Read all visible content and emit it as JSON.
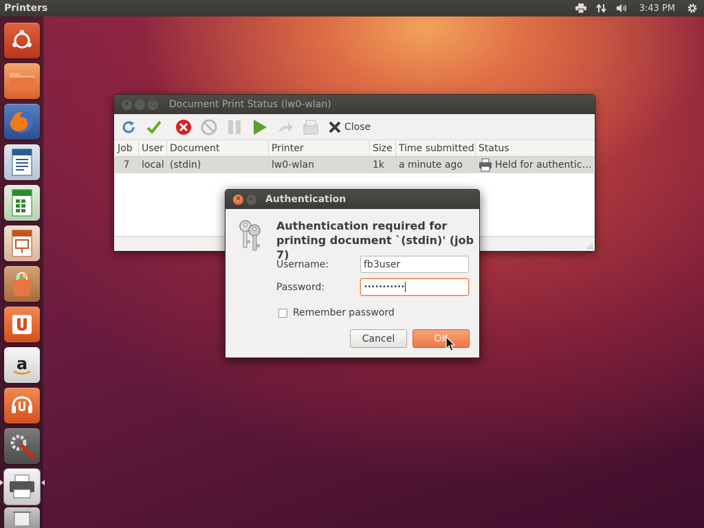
{
  "topbar": {
    "app_title": "Printers",
    "time": "3:43 PM",
    "tray_icons": [
      "printer-icon",
      "network-icon",
      "volume-icon",
      "gear-icon"
    ]
  },
  "launcher": {
    "items": [
      "dash-home-icon",
      "files-icon",
      "firefox-icon",
      "writer-icon",
      "calc-icon",
      "impress-icon",
      "software-center-icon",
      "ubuntu-one-icon",
      "amazon-icon",
      "ubuntu-one-music-icon",
      "system-settings-icon",
      "printer-app-icon",
      "trash-icon"
    ]
  },
  "print_status_window": {
    "title": "Document Print Status (lw0-wlan)",
    "toolbar": {
      "icons": [
        "refresh-icon",
        "release-icon",
        "cancel-job-icon",
        "delete-job-icon",
        "hold-icon",
        "start-icon",
        "reprint-icon",
        "retrieve-icon"
      ],
      "close_label": "Close"
    },
    "columns": [
      "Job",
      "User",
      "Document",
      "Printer",
      "Size",
      "Time submitted",
      "Status"
    ],
    "rows": [
      {
        "job": "7",
        "user": "local",
        "document": "(stdin)",
        "printer": "lw0-wlan",
        "size": "1k",
        "time_submitted": "a minute ago",
        "status": "Held for authentic…"
      }
    ]
  },
  "auth_dialog": {
    "title": "Authentication",
    "heading": "Authentication required for printing document `(stdin)' (job 7)",
    "username_label": "Username:",
    "username_value": "fb3user",
    "password_label": "Password:",
    "password_value": "•••••••••••",
    "remember_label": "Remember password",
    "remember_checked": false,
    "cancel_label": "Cancel",
    "ok_label": "OK"
  },
  "colors": {
    "accent": "#ed7848",
    "topbar": "#3c3b37"
  }
}
